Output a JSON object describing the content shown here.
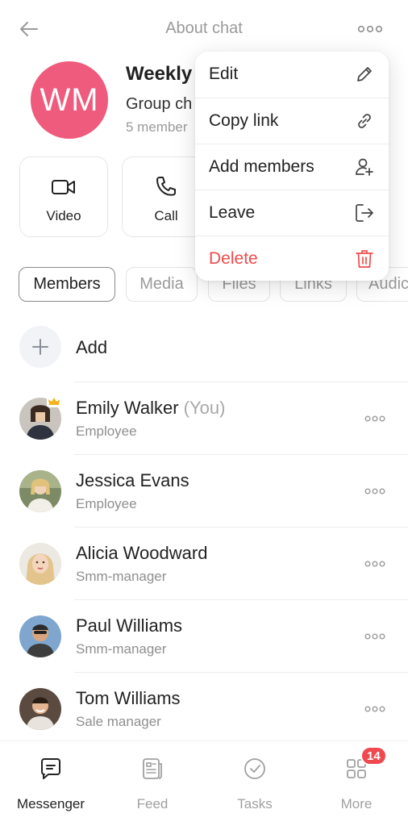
{
  "header": {
    "title": "About chat"
  },
  "chat": {
    "initials": "WM",
    "avatar_color": "#ef5b7c",
    "name": "Weekly",
    "type": "Group ch",
    "members": "5 member"
  },
  "actions": [
    {
      "label": "Video",
      "icon": "video-icon"
    },
    {
      "label": "Call",
      "icon": "phone-icon"
    }
  ],
  "tabs": [
    {
      "label": "Members",
      "active": true
    },
    {
      "label": "Media"
    },
    {
      "label": "Files"
    },
    {
      "label": "Links"
    },
    {
      "label": "Audic"
    }
  ],
  "add": {
    "label": "Add"
  },
  "members": [
    {
      "name": "Emily Walker",
      "suffix": "(You)",
      "role": "Employee",
      "avatar_color": "#3a3f4a",
      "crown": true
    },
    {
      "name": "Jessica Evans",
      "role": "Employee",
      "avatar_color": "#7d8a66"
    },
    {
      "name": "Alicia Woodward",
      "role": "Smm-manager",
      "avatar_color": "#d7b489"
    },
    {
      "name": "Paul Williams",
      "role": "Smm-manager",
      "avatar_color": "#5a86b8"
    },
    {
      "name": "Tom Williams",
      "role": "Sale manager",
      "avatar_color": "#6d5a4c"
    }
  ],
  "menu": [
    {
      "label": "Edit",
      "icon": "pencil-icon"
    },
    {
      "label": "Copy link",
      "icon": "link-icon"
    },
    {
      "label": "Add members",
      "icon": "add-user-icon"
    },
    {
      "label": "Leave",
      "icon": "logout-icon"
    },
    {
      "label": "Delete",
      "icon": "trash-icon",
      "danger": true
    }
  ],
  "nav": [
    {
      "label": "Messenger",
      "icon": "chat-icon",
      "active": true
    },
    {
      "label": "Feed",
      "icon": "feed-icon"
    },
    {
      "label": "Tasks",
      "icon": "check-circle-icon"
    },
    {
      "label": "More",
      "icon": "grid-icon",
      "badge": "14"
    }
  ],
  "colors": {
    "danger": "#ef4b4b",
    "badge": "#f0484f",
    "muted": "#9a9a9a"
  }
}
